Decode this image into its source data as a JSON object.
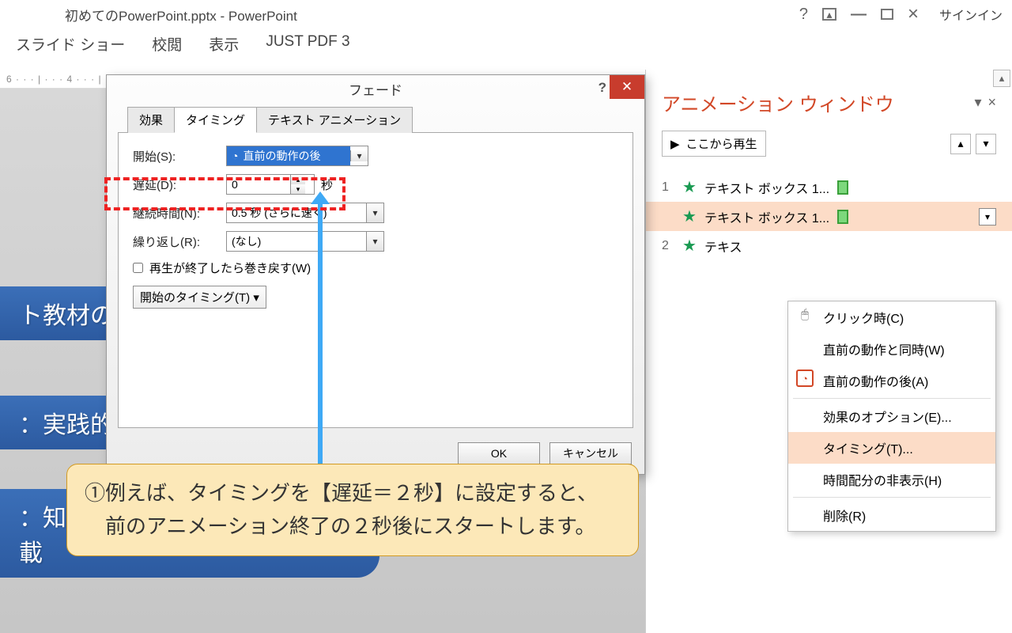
{
  "title": "初めてのPowerPoint.pptx - PowerPoint",
  "signin": "サインイン",
  "ribbon": {
    "slideshow": "スライド ショー",
    "review": "校閲",
    "view": "表示",
    "justpdf": "JUST PDF 3"
  },
  "ruler": "6 · · · | · · · 4 · · · |",
  "dialog": {
    "title": "フェード",
    "tabs": {
      "effect": "効果",
      "timing": "タイミング",
      "textanim": "テキスト アニメーション"
    },
    "rows": {
      "start_label": "開始(S):",
      "start_value": "直前の動作の後",
      "delay_label": "遅延(D):",
      "delay_value": "0",
      "delay_unit": "秒",
      "duration_label": "継続時間(N):",
      "duration_value": "0.5 秒 (さらに速く)",
      "repeat_label": "繰り返し(R):",
      "repeat_value": "(なし)"
    },
    "rewind": "再生が終了したら巻き戻す(W)",
    "start_timing_btn": "開始のタイミング(T) ▾",
    "ok": "OK",
    "cancel": "キャンセル"
  },
  "slide": {
    "pill1": "ト教材の特",
    "pill2": "：実践的",
    "pill3": "：知ってるだけで使えるコツ満載"
  },
  "callout": {
    "line1": "①例えば、タイミングを【遅延＝２秒】に設定すると、",
    "line2": "　前のアニメーション終了の２秒後にスタートします。"
  },
  "pane": {
    "title": "アニメーション ウィンドウ",
    "play": "ここから再生",
    "items": {
      "a_num": "1",
      "a_text": "テキスト ボックス 1...",
      "b_text": "テキスト ボックス 1...",
      "c_num": "2",
      "c_text": "テキス"
    }
  },
  "ctx": {
    "click": "クリック時(C)",
    "with_prev": "直前の動作と同時(W)",
    "after_prev": "直前の動作の後(A)",
    "effect_opts": "効果のオプション(E)...",
    "timing": "タイミング(T)...",
    "hide_timing": "時間配分の非表示(H)",
    "delete": "削除(R)"
  }
}
